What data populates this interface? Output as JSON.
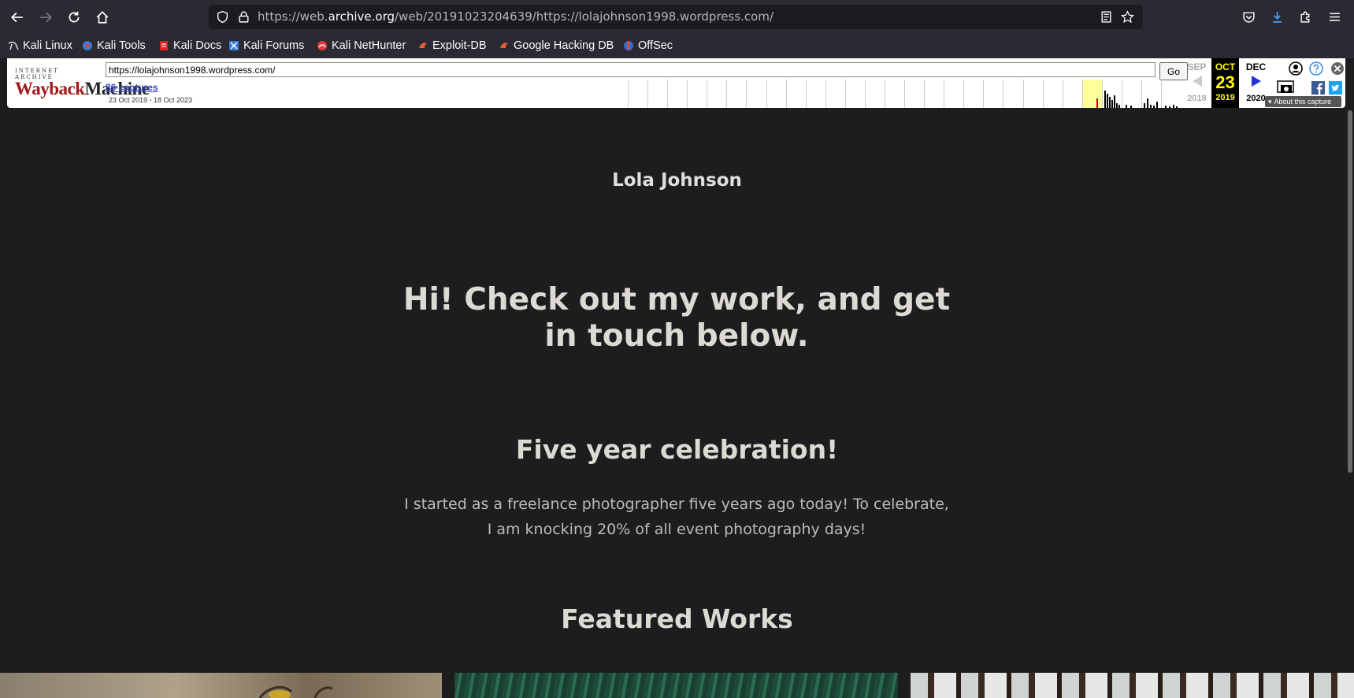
{
  "browser": {
    "url_prefix": "https://web.",
    "url_host": "archive.org",
    "url_rest": "/web/20191023204639/https://lolajohnson1998.wordpress.com/",
    "bookmarks": [
      {
        "label": "Kali Linux",
        "icon": "kali-dragon-icon"
      },
      {
        "label": "Kali Tools",
        "icon": "kali-tools-icon"
      },
      {
        "label": "Kali Docs",
        "icon": "kali-docs-icon"
      },
      {
        "label": "Kali Forums",
        "icon": "kali-forums-icon"
      },
      {
        "label": "Kali NetHunter",
        "icon": "nethunter-icon"
      },
      {
        "label": "Exploit-DB",
        "icon": "exploit-db-icon"
      },
      {
        "label": "Google Hacking DB",
        "icon": "ghdb-icon"
      },
      {
        "label": "OffSec",
        "icon": "offsec-icon"
      }
    ]
  },
  "wayback": {
    "logo_top": "INTERNET ARCHIVE",
    "logo_way": "Wayback",
    "logo_machine": "Machine",
    "url_value": "https://lolajohnson1998.wordpress.com/",
    "go_label": "Go",
    "captures_label": "86 captures",
    "capture_range": "23 Oct 2019 - 18 Oct 2023",
    "prev": {
      "month": "SEP",
      "year": "2018"
    },
    "current": {
      "month": "OCT",
      "day": "23",
      "year": "2019"
    },
    "next": {
      "month": "DEC",
      "year": "2020"
    },
    "about_label": "About this capture"
  },
  "page": {
    "site_title": "Lola Johnson",
    "hero": "Hi! Check out my work, and get in touch below.",
    "section_title": "Five year celebration!",
    "section_text": "I started as a freelance photographer five years ago today! To celebrate, I am knocking 20% of all event photography days!",
    "featured_title": "Featured Works"
  }
}
